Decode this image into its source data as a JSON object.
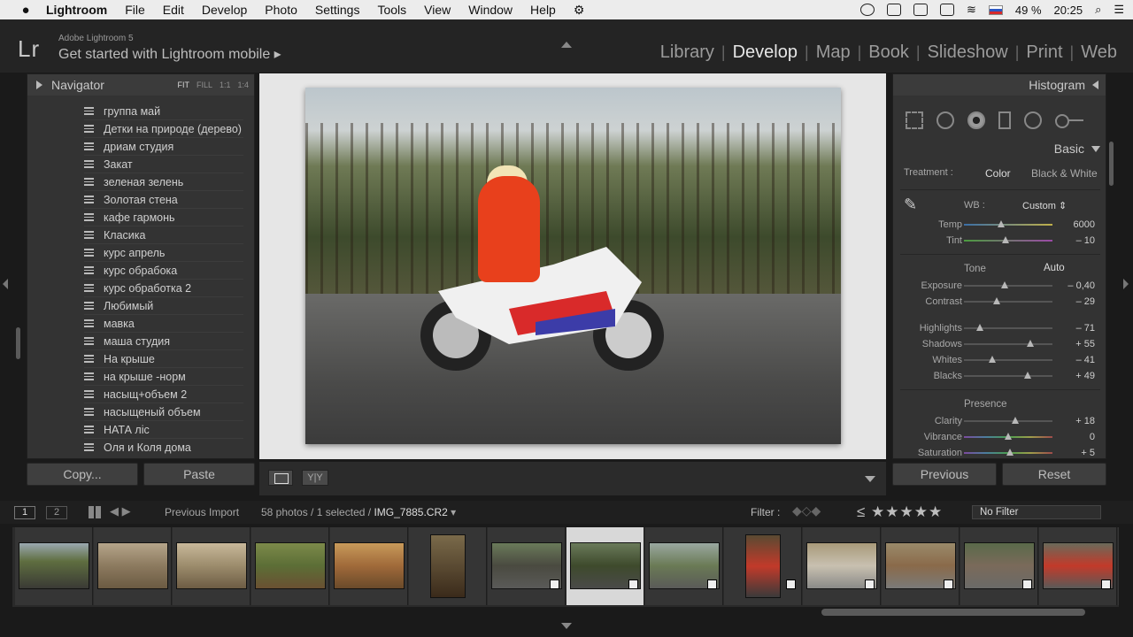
{
  "menubar": {
    "apple": "",
    "app": "Lightroom",
    "items": [
      "File",
      "Edit",
      "Develop",
      "Photo",
      "Settings",
      "Tools",
      "View",
      "Window",
      "Help"
    ],
    "battery": "49 %",
    "time": "20:25"
  },
  "topbar": {
    "logo": "Lr",
    "product": "Adobe Lightroom 5",
    "mobile": "Get started with Lightroom mobile",
    "modules": [
      "Library",
      "Develop",
      "Map",
      "Book",
      "Slideshow",
      "Print",
      "Web"
    ],
    "active_module": "Develop"
  },
  "navigator": {
    "title": "Navigator",
    "opts": [
      "FIT",
      "FILL",
      "1:1",
      "1:4"
    ]
  },
  "presets": [
    "группа май",
    "Детки на природе (дерево)",
    "дриам студия",
    "Закат",
    "зеленая зелень",
    "Золотая стена",
    "кафе гармонь",
    "Класика",
    "курс апрель",
    "курс обрабока",
    "курс обработка 2",
    "Любимый",
    "мавка",
    "маша студия",
    "На крыше",
    "на крыше -норм",
    "насыщ+объем 2",
    "насыщеный объем",
    "НАТА ліс",
    "Оля и Коля дома"
  ],
  "left_buttons": {
    "copy": "Copy...",
    "paste": "Paste"
  },
  "right": {
    "histogram": "Histogram",
    "basic": "Basic",
    "treatment_label": "Treatment :",
    "treatment_color": "Color",
    "treatment_bw": "Black & White",
    "wb_label": "WB :",
    "wb_value": "Custom",
    "tone": "Tone",
    "auto": "Auto",
    "presence": "Presence"
  },
  "sliders": {
    "temp": {
      "label": "Temp",
      "value": "6000",
      "pos": 0.42
    },
    "tint": {
      "label": "Tint",
      "value": "– 10",
      "pos": 0.47
    },
    "exposure": {
      "label": "Exposure",
      "value": "– 0,40",
      "pos": 0.46
    },
    "contrast": {
      "label": "Contrast",
      "value": "– 29",
      "pos": 0.37
    },
    "highlights": {
      "label": "Highlights",
      "value": "– 71",
      "pos": 0.18
    },
    "shadows": {
      "label": "Shadows",
      "value": "+ 55",
      "pos": 0.75
    },
    "whites": {
      "label": "Whites",
      "value": "– 41",
      "pos": 0.32
    },
    "blacks": {
      "label": "Blacks",
      "value": "+ 49",
      "pos": 0.72
    },
    "clarity": {
      "label": "Clarity",
      "value": "+ 18",
      "pos": 0.58
    },
    "vibrance": {
      "label": "Vibrance",
      "value": "0",
      "pos": 0.5
    },
    "saturation": {
      "label": "Saturation",
      "value": "+ 5",
      "pos": 0.52
    }
  },
  "right_buttons": {
    "previous": "Previous",
    "reset": "Reset"
  },
  "filmbar": {
    "screen1": "1",
    "screen2": "2",
    "source": "Previous Import",
    "count": "58 photos / 1 selected /",
    "filename": "IMG_7885.CR2",
    "filter_label": "Filter :",
    "stars": "≤ ★★★★★",
    "no_filter": "No Filter"
  },
  "center_bottom": {
    "yy": "Y|Y"
  }
}
